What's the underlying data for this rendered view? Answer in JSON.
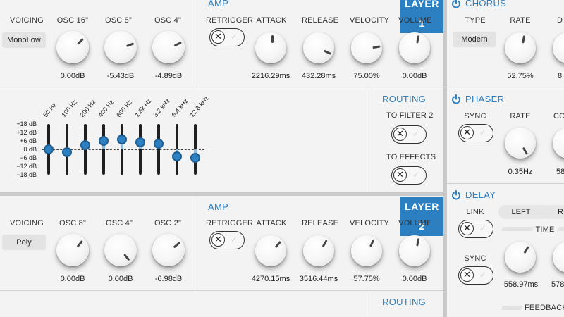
{
  "layer1": {
    "badge": "LAYER 1",
    "voicing": {
      "label": "VOICING",
      "value": "MonoLow"
    },
    "oscs": [
      {
        "label": "OSC 16\"",
        "value": "0.00dB"
      },
      {
        "label": "OSC 8\"",
        "value": "-5.43dB"
      },
      {
        "label": "OSC 4\"",
        "value": "-4.89dB"
      }
    ],
    "amp": {
      "title": "AMP",
      "retrigger": "RETRIGGER",
      "knobs": [
        {
          "label": "ATTACK",
          "value": "2216.29ms"
        },
        {
          "label": "RELEASE",
          "value": "432.28ms"
        },
        {
          "label": "VELOCITY",
          "value": "75.00%"
        },
        {
          "label": "VOLUME",
          "value": "0.00dB"
        }
      ]
    },
    "eq": {
      "db_labels": [
        "+18 dB",
        "+12 dB",
        "+6 dB",
        "0 dB",
        "−6 dB",
        "−12 dB",
        "−18 dB"
      ],
      "bands": [
        {
          "freq": "50 Hz",
          "gain_db": 0
        },
        {
          "freq": "100 Hz",
          "gain_db": -2
        },
        {
          "freq": "200 Hz",
          "gain_db": 3
        },
        {
          "freq": "400 Hz",
          "gain_db": 6
        },
        {
          "freq": "800 Hz",
          "gain_db": 7
        },
        {
          "freq": "1.6k Hz",
          "gain_db": 5
        },
        {
          "freq": "3.2 kHz",
          "gain_db": 4
        },
        {
          "freq": "6.4 kHz",
          "gain_db": -5
        },
        {
          "freq": "12.8 kHz",
          "gain_db": -6
        }
      ]
    },
    "routing": {
      "title": "ROUTING",
      "to_filter": "TO FILTER 2",
      "to_effects": "TO EFFECTS"
    }
  },
  "layer2": {
    "badge": "LAYER 2",
    "voicing": {
      "label": "VOICING",
      "value": "Poly"
    },
    "oscs": [
      {
        "label": "OSC 8\"",
        "value": "0.00dB"
      },
      {
        "label": "OSC 4\"",
        "value": "0.00dB"
      },
      {
        "label": "OSC 2\"",
        "value": "-6.98dB"
      }
    ],
    "amp": {
      "title": "AMP",
      "retrigger": "RETRIGGER",
      "knobs": [
        {
          "label": "ATTACK",
          "value": "4270.15ms"
        },
        {
          "label": "RELEASE",
          "value": "3516.44ms"
        },
        {
          "label": "VELOCITY",
          "value": "57.75%"
        },
        {
          "label": "VOLUME",
          "value": "0.00dB"
        }
      ]
    },
    "routing": {
      "title": "ROUTING"
    }
  },
  "effects": {
    "chorus": {
      "title": "CHORUS",
      "type_label": "TYPE",
      "type_value": "Modern",
      "rate_label": "RATE",
      "rate_value": "52.75%",
      "partial_label": "D",
      "partial_value": "8"
    },
    "phaser": {
      "title": "PHASER",
      "sync_label": "SYNC",
      "rate_label": "RATE",
      "rate_value": "0.35Hz",
      "partial_label": "CO",
      "partial_value": "58"
    },
    "delay": {
      "title": "DELAY",
      "link_label": "LINK",
      "left_label": "LEFT",
      "right_partial": "R",
      "time_label": "TIME",
      "sync_label": "SYNC",
      "time_value": "558.97ms",
      "partial_value": "578",
      "feedback_label": "FEEDBACK"
    }
  },
  "colors": {
    "accent": "#2c7fc1",
    "background": "#f3f3f3",
    "divider": "#cfcfcf"
  }
}
